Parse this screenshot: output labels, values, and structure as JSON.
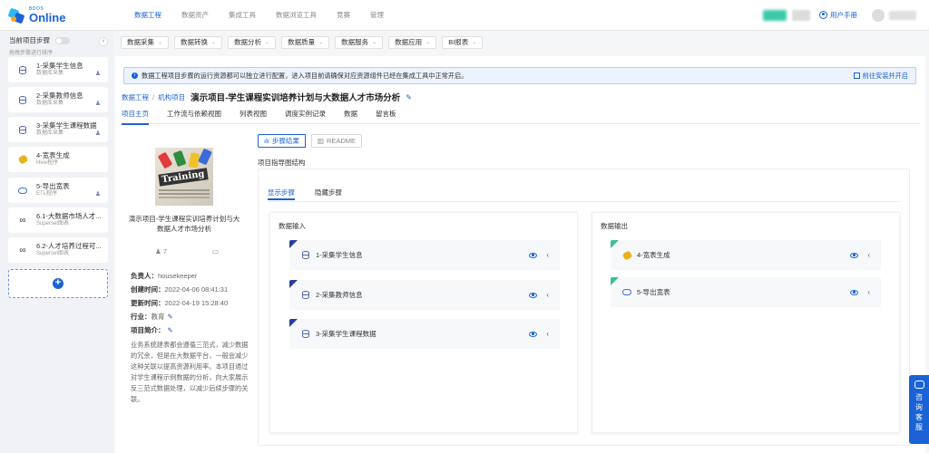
{
  "logo": {
    "small": "BDOS",
    "big": "Online"
  },
  "topnav": [
    {
      "label": "数据工程",
      "active": true
    },
    {
      "label": "数据资产",
      "active": false
    },
    {
      "label": "集成工具",
      "active": false
    },
    {
      "label": "数据浏览工具",
      "active": false
    },
    {
      "label": "竞赛",
      "active": false
    },
    {
      "label": "管理",
      "active": false
    }
  ],
  "header": {
    "user_manual": "用户手册"
  },
  "sidebar": {
    "title": "当前项目步骤",
    "subtitle": "拖拽步骤进行排序",
    "steps": [
      {
        "name": "1-采集学生信息",
        "type": "数据库采集",
        "icon": "database-icon"
      },
      {
        "name": "2-采集教师信息",
        "type": "数据库采集",
        "icon": "database-icon"
      },
      {
        "name": "3-采集学生课程数据",
        "type": "数据库采集",
        "icon": "database-icon"
      },
      {
        "name": "4-宽表生成",
        "type": "Hive程序",
        "icon": "hive-icon"
      },
      {
        "name": "5-导出宽表",
        "type": "ETL程序",
        "icon": "etl-icon"
      },
      {
        "name": "6.1-大数据市场人才...",
        "type": "Superset图表",
        "icon": "superset-icon"
      },
      {
        "name": "6.2-人才培养过程可...",
        "type": "Superset图表",
        "icon": "superset-icon"
      }
    ]
  },
  "subnav": [
    "数据采集",
    "数据转换",
    "数据分析",
    "数据质量",
    "数据服务",
    "数据应用",
    "BI报表"
  ],
  "notice": {
    "text": "数据工程项目步骤的运行资源都可以独立进行配置，进入项目前请确保对应资源组件已经在集成工具中正常开启。",
    "link": "前往安装并开启"
  },
  "breadcrumb": {
    "c1": "数据工程",
    "c2": "机构项目",
    "title": "演示项目-学生课程实训培养计划与大数据人才市场分析"
  },
  "tabs": [
    "项目主页",
    "工作流与依赖视图",
    "列表视图",
    "调度实例记录",
    "数据",
    "留言板"
  ],
  "project": {
    "image_word": "Training",
    "title": "演示项目-学生课程实训培养计划与大数据人才市场分析",
    "members": "7",
    "owner_label": "负责人：",
    "owner": "housekeeper",
    "created_label": "创建时间：",
    "created": "2022-04-06 08:41:31",
    "updated_label": "更新时间：",
    "updated": "2022-04-19 15:28:40",
    "industry_label": "行业：",
    "industry": "教育",
    "intro_label": "项目简介：",
    "intro": "业务系统建表都会遵循三范式，减少数据的冗余，但是在大数据平台，一般会减少这种关联以提高资源利用率。本项目通过对学生课程示例数据的分析，向大家展示反三范式数据处理，以减少后续步骤的关联。"
  },
  "view_toggle": {
    "steps": "步骤结果",
    "readme": "README"
  },
  "structure": {
    "title": "项目指导图结构",
    "tabs": [
      "显示步骤",
      "隐藏步骤"
    ],
    "input_title": "数据输入",
    "output_title": "数据输出",
    "inputs": [
      "1-采集学生信息",
      "2-采集教师信息",
      "3-采集学生课程数据"
    ],
    "outputs": [
      "4-宽表生成",
      "5-导出宽表"
    ]
  },
  "consult": "咨询客服",
  "colors": {
    "accent": "#1a62d6",
    "teal": "#3dbb9a",
    "navy": "#2c3e9e"
  }
}
